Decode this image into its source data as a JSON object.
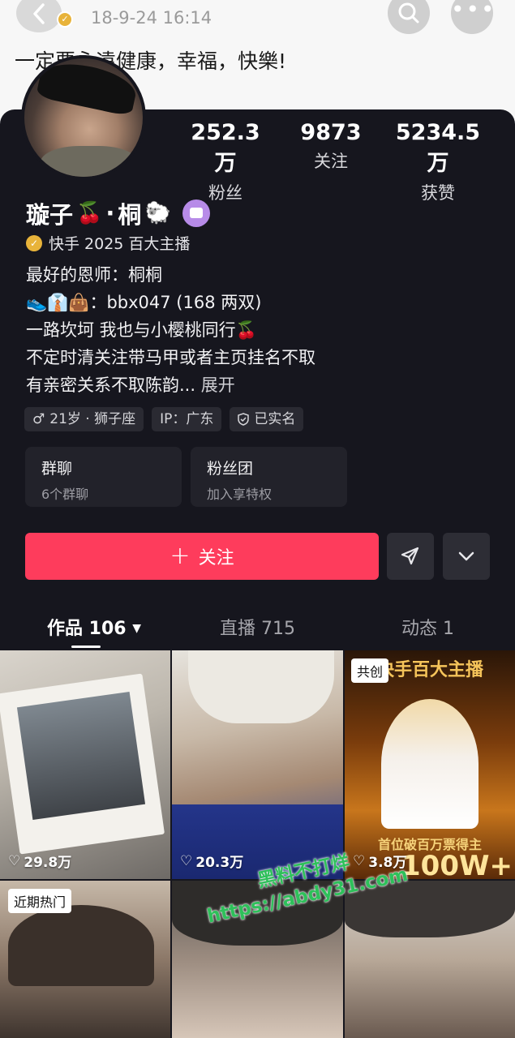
{
  "background_post": {
    "time": "18-9-24 16:14",
    "text": "一定要永遠健康，幸福，快樂!"
  },
  "profile": {
    "stats": [
      {
        "value": "252.3万",
        "label": "粉丝"
      },
      {
        "value": "9873",
        "label": "关注"
      },
      {
        "value": "5234.5万",
        "label": "获赞"
      }
    ],
    "name_part1": "璇子",
    "name_emoji1": "🍒",
    "name_sep": "·",
    "name_part2": "桐",
    "name_emoji2": "🐑",
    "verification": "快手 2025 百大主播",
    "bio_lines": [
      "最好的恩师：桐桐",
      "👟👔👜：bbx047 (168 两双)",
      "一路坎坷 我也与小樱桃同行🍒",
      "不定时清关注带马甲或者主页挂名不取",
      "有亲密关系不取陈韵..."
    ],
    "expand_label": "展开",
    "tags": [
      "21岁 · 狮子座",
      "IP：广东",
      "已实名"
    ]
  },
  "cards": [
    {
      "title": "群聊",
      "subtitle": "6个群聊"
    },
    {
      "title": "粉丝团",
      "subtitle": "加入享特权"
    }
  ],
  "actions": {
    "follow_label": "关注"
  },
  "tabs": [
    {
      "label": "作品 106"
    },
    {
      "label": "直播 715"
    },
    {
      "label": "动态 1"
    }
  ],
  "grid": [
    {
      "likes": "29.8万"
    },
    {
      "likes": "20.3万"
    },
    {
      "likes": "3.8万",
      "tag": "共创"
    },
    {
      "tag": "近期热门"
    },
    {},
    {}
  ],
  "watermark": {
    "line1": "黑料不打烊",
    "line2": "https://abdy31.com"
  },
  "colors": {
    "accent": "#fe3c5c",
    "sheet_bg": "#16161e"
  }
}
